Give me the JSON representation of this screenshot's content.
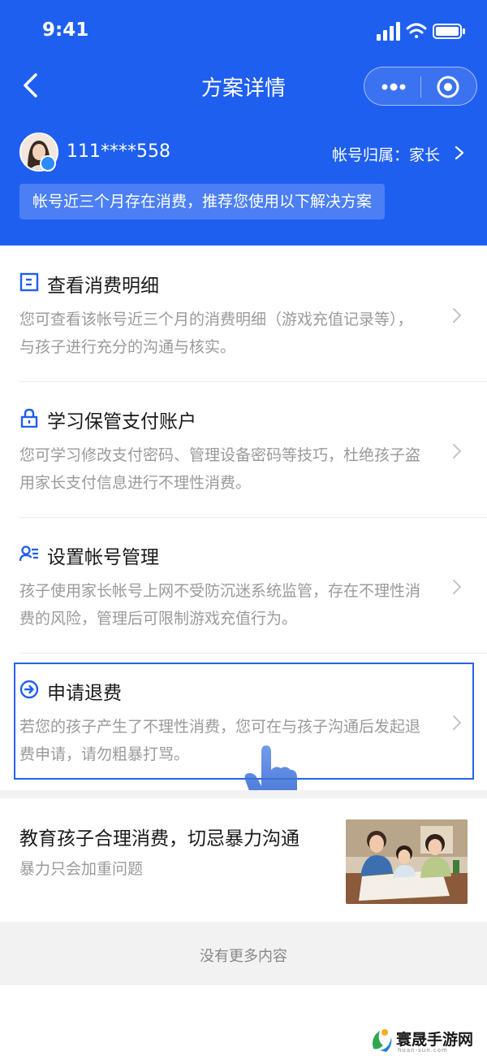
{
  "status_bar": {
    "time": "9:41"
  },
  "nav": {
    "title": "方案详情"
  },
  "account": {
    "id": "111****558",
    "ownership": "帐号归属：家长",
    "notice": "帐号近三个月存在消费，推荐您使用以下解决方案"
  },
  "solutions": [
    {
      "title": "查看消费明细",
      "desc": "您可查看该帐号近三个月的消费明细（游戏充值记录等），与孩子进行充分的沟通与核实。",
      "icon": "bill-icon"
    },
    {
      "title": "学习保管支付账户",
      "desc": "您可学习修改支付密码、管理设备密码等技巧，杜绝孩子盗用家长支付信息进行不理性消费。",
      "icon": "lock-icon"
    },
    {
      "title": "设置帐号管理",
      "desc": "孩子使用家长帐号上网不受防沉迷系统监管，存在不理性消费的风险，管理后可限制游戏充值行为。",
      "icon": "user-manage-icon"
    },
    {
      "title": "申请退费",
      "desc": "若您的孩子产生了不理性消费，您可在与孩子沟通后发起退费申请，请勿粗暴打骂。",
      "icon": "arrow-circle-icon"
    }
  ],
  "article": {
    "title": "教育孩子合理消费，切忌暴力沟通",
    "subtitle": "暴力只会加重问题"
  },
  "footer": {
    "no_more": "没有更多内容"
  },
  "watermark": {
    "name": "寰晟手游网",
    "url": "huan-sun.com"
  },
  "colors": {
    "brand_blue": "#1f5ff0",
    "highlight": "#2663e8",
    "muted_text": "#9a9a9a"
  }
}
